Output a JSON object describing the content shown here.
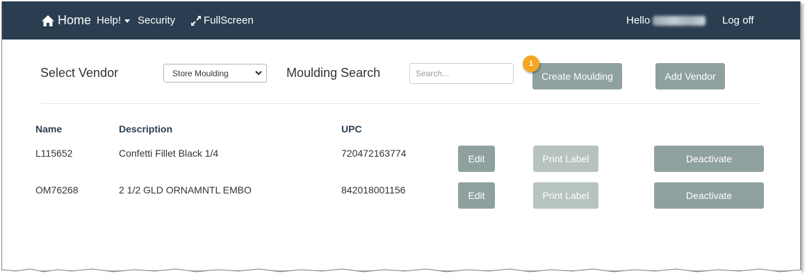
{
  "navbar": {
    "home_label": "Home",
    "help_label": "Help!",
    "security_label": "Security",
    "fullscreen_label": "FullScreen",
    "hello_label": "Hello",
    "logoff_label": "Log off",
    "background_color": "#2b3e51"
  },
  "toolbar": {
    "select_vendor_label": "Select Vendor",
    "vendor_selected": "Store Moulding",
    "moulding_search_label": "Moulding Search",
    "search_placeholder": "Search...",
    "search_value": "",
    "create_moulding_label": "Create Moulding",
    "add_vendor_label": "Add Vendor",
    "callout_number": "1",
    "callout_color": "#f5a623",
    "button_color": "#8fa19f"
  },
  "table": {
    "headers": {
      "name": "Name",
      "description": "Description",
      "upc": "UPC"
    },
    "rows": [
      {
        "name": "L115652",
        "description": "Confetti Fillet Black 1/4",
        "upc": "720472163774",
        "edit_label": "Edit",
        "print_label": "Print Label",
        "deactivate_label": "Deactivate"
      },
      {
        "name": "OM76268",
        "description": "2 1/2 GLD ORNAMNTL EMBO",
        "upc": "842018001156",
        "edit_label": "Edit",
        "print_label": "Print Label",
        "deactivate_label": "Deactivate"
      }
    ]
  },
  "icons": {
    "home": "home-icon",
    "help_caret": "chevron-down-icon",
    "fullscreen": "expand-icon",
    "select_caret": "chevron-down-icon"
  }
}
